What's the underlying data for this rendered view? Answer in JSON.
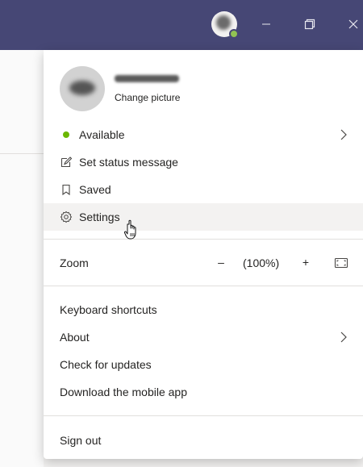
{
  "titlebar": {
    "bg": "#464775",
    "minimize_icon": "minimize-icon",
    "maximize_icon": "restore-icon",
    "close_icon": "close-icon"
  },
  "profile": {
    "change_picture": "Change picture"
  },
  "menu": {
    "available": "Available",
    "set_status": "Set status message",
    "saved": "Saved",
    "settings": "Settings",
    "zoom_label": "Zoom",
    "zoom_minus": "–",
    "zoom_value": "(100%)",
    "zoom_plus": "+",
    "keyboard_shortcuts": "Keyboard shortcuts",
    "about": "About",
    "check_updates": "Check for updates",
    "download_mobile": "Download the mobile app",
    "sign_out": "Sign out"
  },
  "colors": {
    "available": "#6bb700",
    "hover": "#f3f2f1",
    "text": "#252423"
  }
}
